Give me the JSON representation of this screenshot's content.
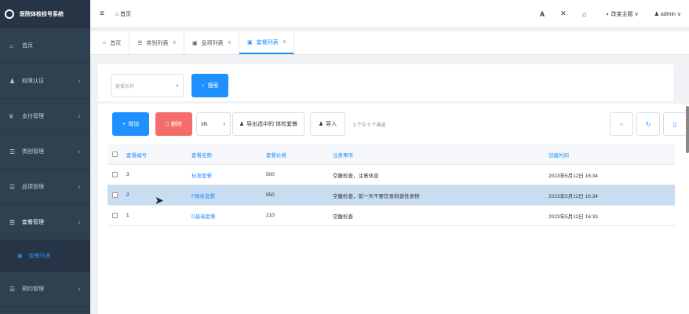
{
  "app": {
    "title": "医院体检挂号系统"
  },
  "sidebar": {
    "items": [
      {
        "label": "首页",
        "icon": "home-icon"
      },
      {
        "label": "权限认证",
        "icon": "users-icon"
      },
      {
        "label": "支付管理",
        "icon": "pay-icon"
      },
      {
        "label": "类别管理",
        "icon": "grid-icon"
      },
      {
        "label": "品项管理",
        "icon": "grid-icon"
      },
      {
        "label": "套餐管理",
        "icon": "grid-icon"
      },
      {
        "label": "预约管理",
        "icon": "grid-icon"
      }
    ],
    "sub_item": {
      "label": "套餐列表"
    }
  },
  "topbar": {
    "breadcrumb": "首页",
    "theme_label": "改变主题",
    "user_label": "admin"
  },
  "tabs": [
    {
      "label": "首页"
    },
    {
      "label": "类别列表"
    },
    {
      "label": "品项列表"
    },
    {
      "label": "套餐列表"
    }
  ],
  "search": {
    "placeholder": "套餐名称",
    "button": "搜索"
  },
  "toolbar": {
    "add": "增加",
    "delete": "删除",
    "format": "xls",
    "export": "导出选中的 体检套餐",
    "import": "导入",
    "selection_info": "3 个中 0 个被选"
  },
  "table": {
    "headers": [
      "套餐编号",
      "套餐名称",
      "套餐价格",
      "注意事项",
      "创建时间"
    ],
    "rows": [
      [
        "3",
        "标准套餐",
        "500",
        "空腹检查，注意休息",
        "2023年5月12日 16:34"
      ],
      [
        "2",
        "F精英套餐",
        "950",
        "空腹检查，前一天不要饮食刺激性食物",
        "2023年5月12日 16:34"
      ],
      [
        "1",
        "D基础套餐",
        "210",
        "空腹检查",
        "2023年5月12日 16:33"
      ]
    ]
  },
  "colors": {
    "sidebar": "#2f4050",
    "accent": "#1e90ff",
    "danger": "#f56c6c",
    "selected_row": "#c8ddf1"
  }
}
